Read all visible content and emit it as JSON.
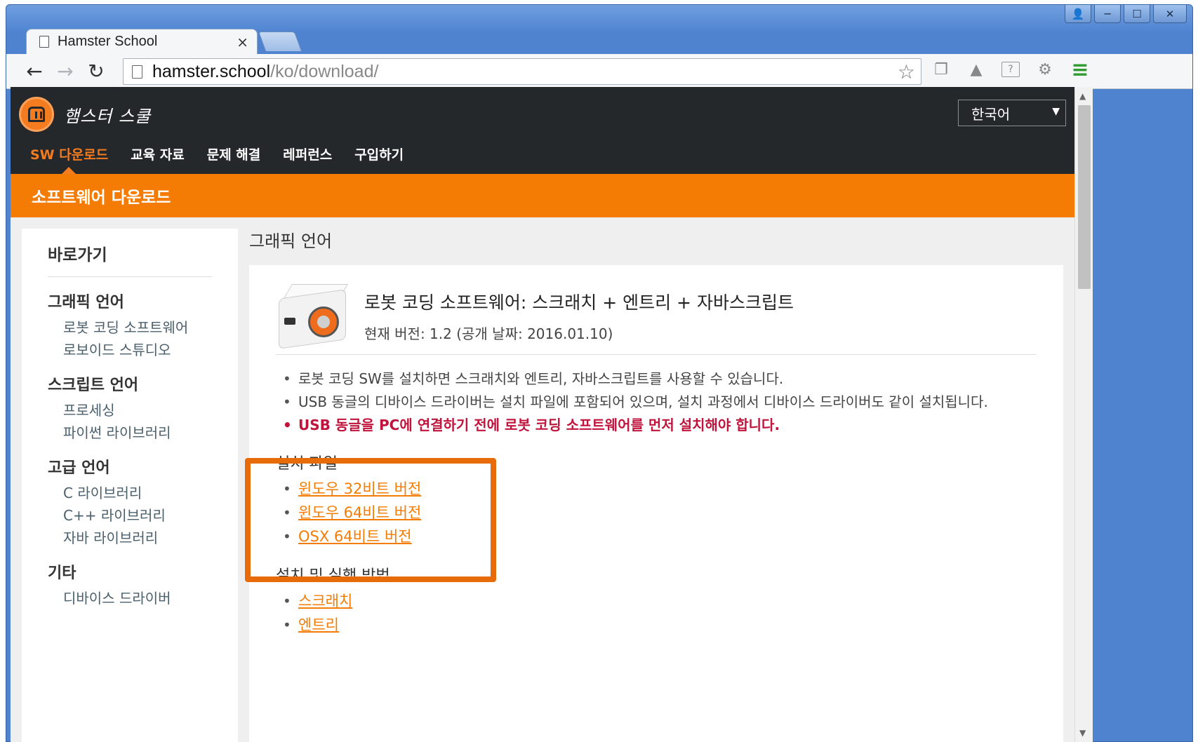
{
  "browser": {
    "tab_title": "Hamster School",
    "tab_close": "×",
    "url_host": "hamster.school",
    "url_path": "/ko/download/",
    "window_buttons": [
      "👤",
      "─",
      "☐",
      "✕"
    ],
    "extension_icons": [
      "copy-icon",
      "drive-icon",
      "help-icon",
      "gears-icon",
      "menu-icon"
    ]
  },
  "site": {
    "logo_text": "햄스터 스쿨",
    "language": "한국어",
    "nav": [
      {
        "label": "SW 다운로드",
        "active": true
      },
      {
        "label": "교육 자료"
      },
      {
        "label": "문제 해결"
      },
      {
        "label": "레퍼런스"
      },
      {
        "label": "구입하기"
      }
    ],
    "banner_title": "소프트웨어 다운로드"
  },
  "sidebar": {
    "title": "바로가기",
    "groups": [
      {
        "title": "그래픽 언어",
        "links": [
          "로봇 코딩 소프트웨어",
          "로보이드 스튜디오"
        ]
      },
      {
        "title": "스크립트 언어",
        "links": [
          "프로세싱",
          "파이썬 라이브러리"
        ]
      },
      {
        "title": "고급 언어",
        "links": [
          "C 라이브러리",
          "C++ 라이브러리",
          "자바 라이브러리"
        ]
      },
      {
        "title": "기타",
        "links": [
          "디바이스 드라이버"
        ]
      }
    ]
  },
  "content": {
    "heading": "그래픽 언어",
    "product_title": "로봇 코딩 소프트웨어: 스크래치 + 엔트리 + 자바스크립트",
    "product_version": "현재 버전: 1.2 (공개 날짜: 2016.01.10)",
    "info": [
      "로봇 코딩 SW를 설치하면 스크래치와 엔트리, 자바스크립트를 사용할 수 있습니다.",
      "USB 동글의 디바이스 드라이버는 설치 파일에 포함되어 있으며, 설치 과정에서 디바이스 드라이버도 같이 설치됩니다.",
      "USB 동글을 PC에 연결하기 전에 로봇 코딩 소프트웨어를 먼저 설치해야 합니다."
    ],
    "install_title": "설치 파일",
    "install_links": [
      "윈도우 32비트 버전",
      "윈도우 64비트 버전",
      "OSX 64비트 버전"
    ],
    "howto_title": "설치 및 실행 방법",
    "howto_links": [
      "스크래치",
      "엔트리"
    ]
  },
  "colors": {
    "accent": "#f47c04",
    "header_bg": "#25282b",
    "warning": "#c0143c",
    "highlight_box": "#e86b0a"
  }
}
